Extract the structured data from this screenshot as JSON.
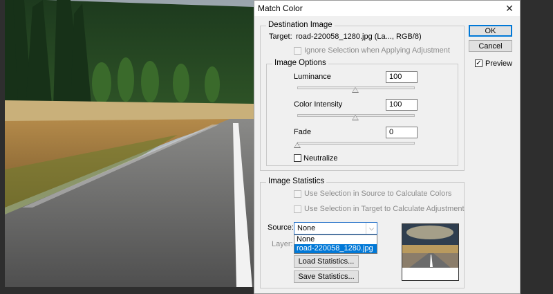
{
  "window": {
    "title": "Match Color",
    "close_icon": "close-icon"
  },
  "destination": {
    "group_label": "Destination Image",
    "target_label": "Target:",
    "target_value": "road-220058_1280.jpg (La..., RGB/8)",
    "ignore_selection_label": "Ignore Selection when Applying Adjustment",
    "ignore_selection_checked": false
  },
  "image_options": {
    "group_label": "Image Options",
    "luminance": {
      "label": "Luminance",
      "value": "100",
      "level": 100,
      "max": 200
    },
    "color_intensity": {
      "label": "Color Intensity",
      "value": "100",
      "level": 100,
      "max": 200
    },
    "fade": {
      "label": "Fade",
      "value": "0",
      "level": 0,
      "max": 100
    },
    "neutralize_label": "Neutralize",
    "neutralize_checked": false
  },
  "statistics": {
    "group_label": "Image Statistics",
    "use_sel_source_label": "Use Selection in Source to Calculate Colors",
    "use_sel_target_label": "Use Selection in Target to Calculate Adjustment",
    "source_label": "Source:",
    "source_value": "None",
    "source_options": [
      "None",
      "road-220058_1280.jpg"
    ],
    "source_highlighted": "road-220058_1280.jpg",
    "layer_label": "Layer:",
    "load_label": "Load Statistics...",
    "save_label": "Save Statistics..."
  },
  "buttons": {
    "ok": "OK",
    "cancel": "Cancel"
  },
  "preview": {
    "label": "Preview",
    "checked": true,
    "check_mark": "✓"
  },
  "colors": {
    "accent": "#0078d7",
    "dialog_bg": "#f0f0f0"
  }
}
